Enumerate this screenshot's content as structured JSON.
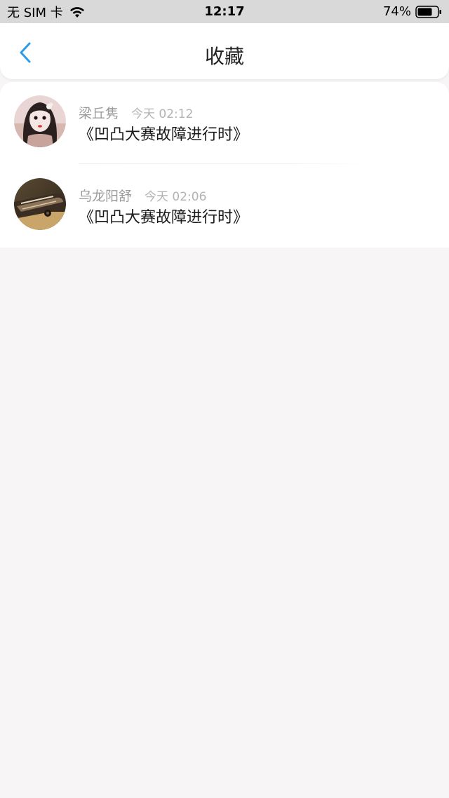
{
  "status_bar": {
    "carrier": "无 SIM 卡",
    "time": "12:17",
    "battery": "74%",
    "battery_level": 0.74,
    "icons": [
      "wifi-icon",
      "battery-icon"
    ]
  },
  "header": {
    "title": "收藏",
    "back_icon": "chevron-left-icon",
    "accent_color": "#2f9be8"
  },
  "favorites": [
    {
      "author": "梁丘隽",
      "time": "今天 02:12",
      "title": "《凹凸大赛故障进行时》"
    },
    {
      "author": "乌龙阳舒",
      "time": "今天 02:06",
      "title": "《凹凸大赛故障进行时》"
    }
  ]
}
